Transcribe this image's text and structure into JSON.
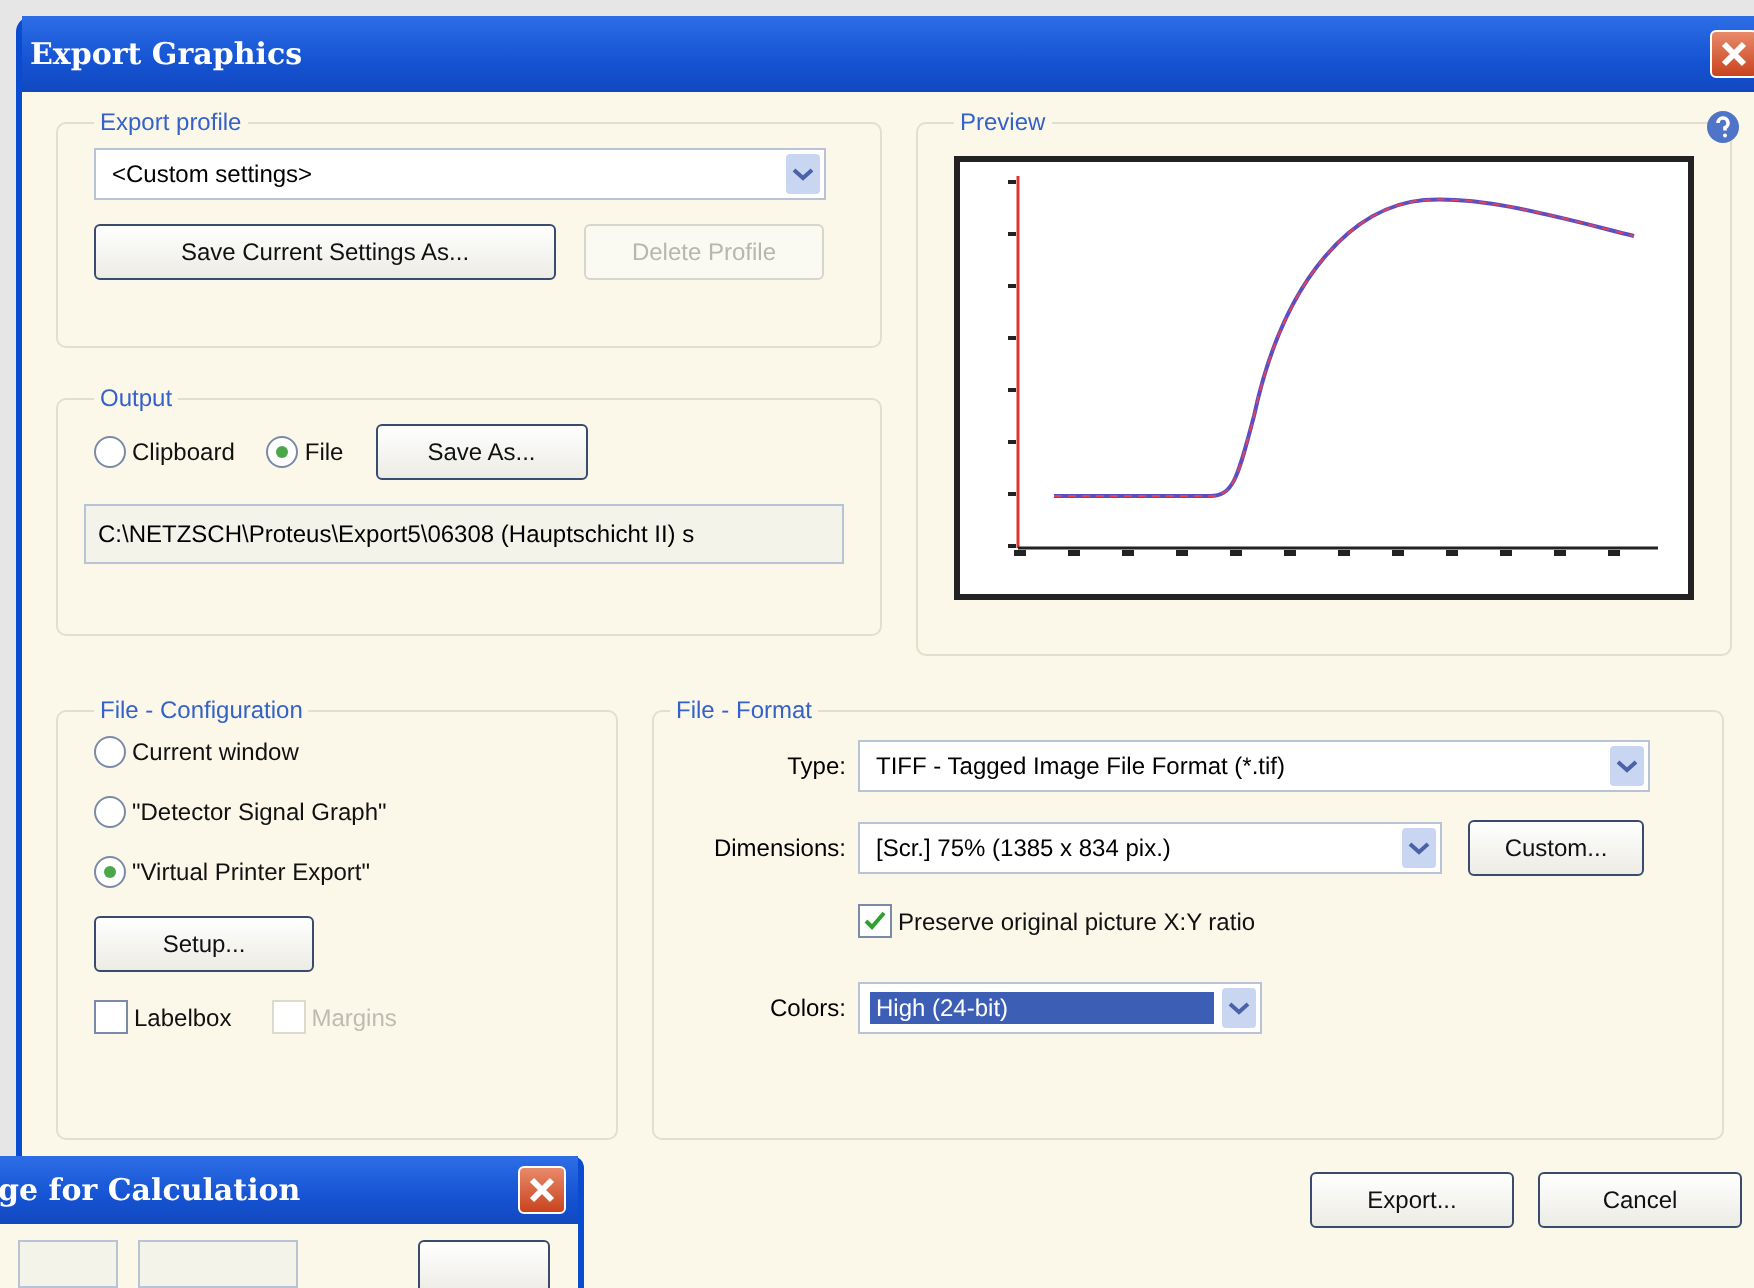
{
  "window": {
    "title": "Export Graphics"
  },
  "export_profile": {
    "title": "Export profile",
    "profile": "<Custom settings>",
    "buttons": [
      {
        "label": "Save Current Settings As...",
        "disabled": false
      },
      {
        "label": "Delete Profile",
        "disabled": true
      }
    ]
  },
  "output": {
    "title": "Output",
    "options": [
      {
        "label": "Clipboard",
        "selected": false
      },
      {
        "label": "File",
        "selected": true
      }
    ],
    "save_as": "Save As...",
    "path": "C:\\NETZSCH\\Proteus\\Export5\\06308 (Hauptschicht II) s"
  },
  "preview": {
    "title": "Preview"
  },
  "file_configuration": {
    "title": "File - Configuration",
    "options": [
      {
        "label": "Current window",
        "selected": false
      },
      {
        "label": "\"Detector Signal Graph\"",
        "selected": false
      },
      {
        "label": "\"Virtual Printer Export\"",
        "selected": true
      }
    ],
    "setup": "Setup...",
    "checkboxes": [
      {
        "label": "Labelbox",
        "checked": false,
        "disabled": false
      },
      {
        "label": "Margins",
        "checked": false,
        "disabled": true
      }
    ]
  },
  "file_format": {
    "title": "File - Format",
    "type_label": "Type:",
    "type": "TIFF - Tagged Image File Format (*.tif)",
    "dimensions_label": "Dimensions:",
    "dimensions": "[Scr.]  75%  (1385 x 834 pix.)",
    "custom": "Custom...",
    "preserve": {
      "label": "Preserve original picture X:Y ratio",
      "checked": true,
      "disabled": false
    },
    "colors_label": "Colors:",
    "colors": "High (24-bit)",
    "colors_focused": true
  },
  "buttons": [
    "Export...",
    "Cancel"
  ],
  "second_window": {
    "title": "ge for Calculation"
  }
}
